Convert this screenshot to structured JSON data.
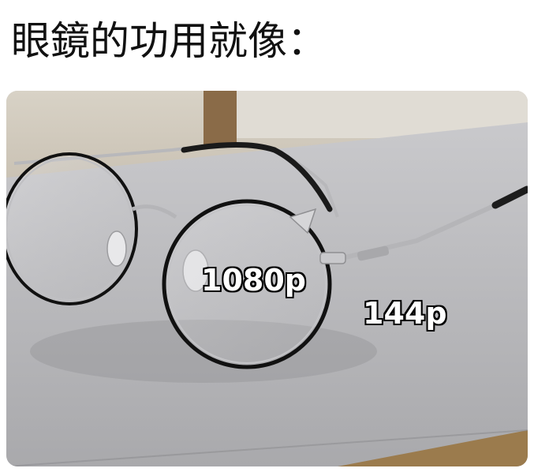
{
  "caption": "眼鏡的功用就像：",
  "photo": {
    "subject": "eyeglasses-on-table",
    "labels": {
      "inside_lens": "1080p",
      "outside_lens": "144p"
    }
  }
}
